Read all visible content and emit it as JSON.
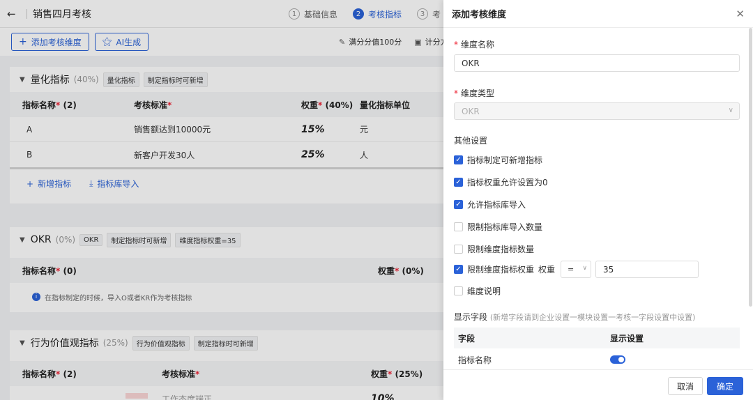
{
  "page": {
    "title": "销售四月考核",
    "steps": [
      {
        "num": "1",
        "label": "基础信息"
      },
      {
        "num": "2",
        "label": "考核指标"
      },
      {
        "num": "3",
        "label": "考"
      }
    ]
  },
  "toolbar": {
    "add_dimension": "添加考核维度",
    "ai_generate": "AI生成",
    "full_score": "满分分值100分",
    "scoring": "计分方"
  },
  "sections": [
    {
      "title": "量化指标",
      "pct": "(40%)",
      "tags": [
        "量化指标",
        "制定指标时可新增"
      ],
      "headers": [
        "指标名称",
        "(2)",
        "考核标准",
        "权重",
        "(40%)",
        "量化指标单位"
      ],
      "rows": [
        {
          "name": "A",
          "standard": "销售额达到10000元",
          "weight": "15%",
          "unit": "元"
        },
        {
          "name": "B",
          "standard": "新客户开发30人",
          "weight": "25%",
          "unit": "人"
        }
      ],
      "add_label": "新增指标",
      "import_label": "指标库导入"
    },
    {
      "title": "OKR",
      "pct": "(0%)",
      "tags": [
        "OKR",
        "制定指标时可新增",
        "维度指标权重=35"
      ],
      "headers": [
        "指标名称",
        "(0)",
        "权重",
        "(0%)"
      ],
      "info": "在指标制定的时候，导入O或者KR作为考核指标"
    },
    {
      "title": "行为价值观指标",
      "pct": "(25%)",
      "tags": [
        "行为价值观指标",
        "制定指标时可新增"
      ],
      "headers": [
        "指标名称",
        "(2)",
        "考核标准",
        "权重",
        "(25%)"
      ],
      "partial_row": {
        "standard": "工作态度端正",
        "weight": "10%"
      }
    }
  ],
  "drawer": {
    "title": "添加考核维度",
    "name_label": "维度名称",
    "name_value": "OKR",
    "type_label": "维度类型",
    "type_value": "OKR",
    "other_label": "其他设置",
    "options": [
      {
        "label": "指标制定可新增指标",
        "checked": true
      },
      {
        "label": "指标权重允许设置为0",
        "checked": true
      },
      {
        "label": "允许指标库导入",
        "checked": true
      },
      {
        "label": "限制指标库导入数量",
        "checked": false
      },
      {
        "label": "限制维度指标数量",
        "checked": false
      },
      {
        "label": "限制维度指标权重",
        "checked": true
      },
      {
        "label": "维度说明",
        "checked": false
      }
    ],
    "weight_label": "权重",
    "weight_op": "=",
    "weight_value": "35",
    "fields_label": "显示字段",
    "fields_note": "(新增字段请到企业设置一模块设置一考核一字段设置中设置)",
    "fields_headers": [
      "字段",
      "显示设置"
    ],
    "field_rows": [
      {
        "name": "指标名称",
        "shown": true
      }
    ],
    "cancel": "取消",
    "ok": "确定"
  },
  "colors": {
    "primary": "#2b62d8",
    "required": "#ee2233"
  }
}
